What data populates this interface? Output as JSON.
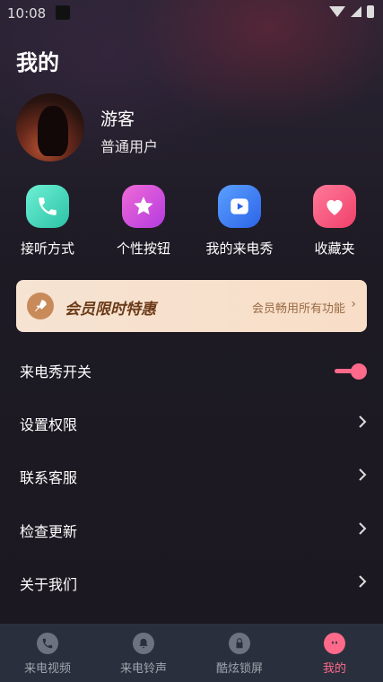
{
  "status_bar": {
    "time": "10:08"
  },
  "header": {
    "title": "我的"
  },
  "profile": {
    "name": "游客",
    "level": "普通用户"
  },
  "quick_actions": [
    {
      "label": "接听方式",
      "icon": "phone-icon",
      "color": "#3fd3b5"
    },
    {
      "label": "个性按钮",
      "icon": "star-icon",
      "color": "#d64fd9"
    },
    {
      "label": "我的来电秀",
      "icon": "play-icon",
      "color": "#3c7cf2"
    },
    {
      "label": "收藏夹",
      "icon": "heart-icon",
      "color": "#f0507a"
    }
  ],
  "vip_banner": {
    "title": "会员限时特惠",
    "subtitle": "会员畅用所有功能"
  },
  "menu": [
    {
      "label": "来电秀开关",
      "type": "toggle",
      "on": true
    },
    {
      "label": "设置权限",
      "type": "link"
    },
    {
      "label": "联系客服",
      "type": "link"
    },
    {
      "label": "检查更新",
      "type": "link"
    },
    {
      "label": "关于我们",
      "type": "link"
    }
  ],
  "bottom_nav": [
    {
      "label": "来电视频",
      "icon": "phone-icon",
      "active": false
    },
    {
      "label": "来电铃声",
      "icon": "bell-icon",
      "active": false
    },
    {
      "label": "酷炫锁屏",
      "icon": "lock-icon",
      "active": false
    },
    {
      "label": "我的",
      "icon": "face-icon",
      "active": true
    }
  ],
  "colors": {
    "accent": "#ff6a8a",
    "nav_bg": "#2a2f3d"
  }
}
